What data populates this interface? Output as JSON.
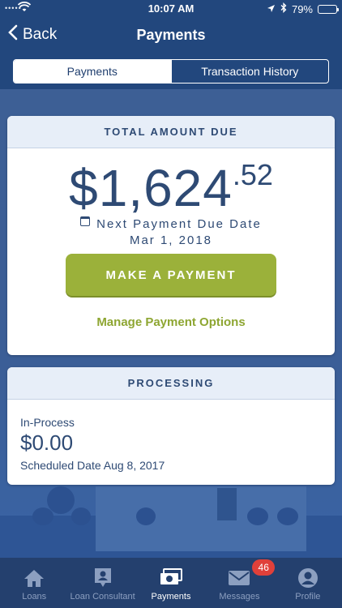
{
  "status_bar": {
    "time": "10:07 AM",
    "battery": "79%",
    "battery_level": 0.79
  },
  "nav": {
    "back_label": "Back",
    "title": "Payments"
  },
  "segments": {
    "payments": "Payments",
    "history": "Transaction History"
  },
  "total_due": {
    "header": "TOTAL AMOUNT DUE",
    "amount_main": "$1,624",
    "amount_cents": ".52",
    "next_due_label": "Next Payment Due Date",
    "next_due_date": "Mar 1, 2018",
    "pay_button": "MAKE A PAYMENT",
    "manage_link": "Manage Payment Options"
  },
  "processing": {
    "header": "PROCESSING",
    "status": "In-Process",
    "amount": "$0.00",
    "scheduled": "Scheduled Date Aug 8, 2017"
  },
  "tabbar": {
    "loans": "Loans",
    "consultant": "Loan Consultant",
    "payments": "Payments",
    "messages": "Messages",
    "messages_badge": "46",
    "profile": "Profile"
  },
  "colors": {
    "primary": "#2e4a74",
    "accent": "#9bb13a",
    "badge": "#e0403a"
  }
}
